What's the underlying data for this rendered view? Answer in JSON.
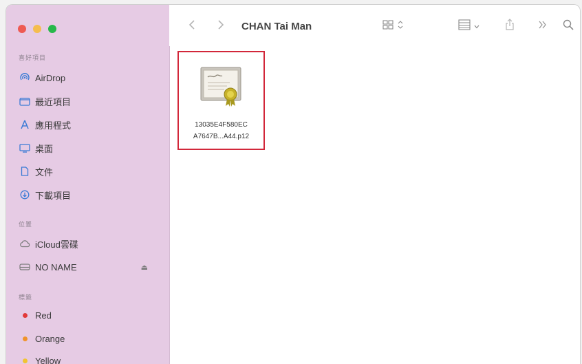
{
  "window": {
    "title": "CHAN Tai Man",
    "traffic_lights": {
      "close": "#ee5a52",
      "minimize": "#f5bd4f",
      "zoom": "#27b84a"
    }
  },
  "sidebar": {
    "favorites_label": "喜好項目",
    "favorites": [
      {
        "label": "AirDrop",
        "icon": "airdrop-icon"
      },
      {
        "label": "最近項目",
        "icon": "recents-icon"
      },
      {
        "label": "應用程式",
        "icon": "applications-icon"
      },
      {
        "label": "桌面",
        "icon": "desktop-icon"
      },
      {
        "label": "文件",
        "icon": "document-icon"
      },
      {
        "label": "下載項目",
        "icon": "downloads-icon"
      }
    ],
    "locations_label": "位置",
    "locations": [
      {
        "label": "iCloud雲碟",
        "icon": "cloud-icon"
      },
      {
        "label": "NO NAME",
        "icon": "drive-icon",
        "ejectable": true
      }
    ],
    "tags_label": "標籤",
    "tags": [
      {
        "label": "Red",
        "color": "#e23a3a"
      },
      {
        "label": "Orange",
        "color": "#f0932b"
      },
      {
        "label": "Yellow",
        "color": "#f2c431"
      }
    ]
  },
  "toolbar": {
    "back_icon": "chevron-left-icon",
    "forward_icon": "chevron-right-icon",
    "view_icon": "grid-view-icon",
    "group_icon": "group-list-icon",
    "share_icon": "share-icon",
    "more_icon": "double-chevron-icon",
    "search_icon": "search-icon"
  },
  "files": [
    {
      "name_line1": "13035E4F580EC",
      "name_line2": "A7647B...A44.p12",
      "icon": "certificate-file-icon",
      "selected": true,
      "highlight_color": "#d2273a"
    }
  ]
}
